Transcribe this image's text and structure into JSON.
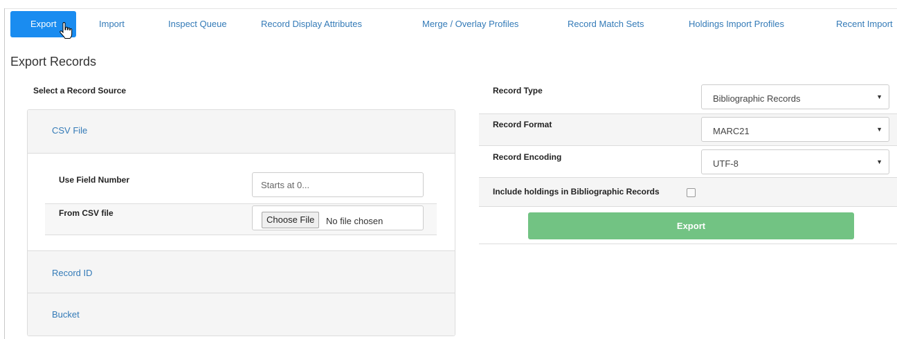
{
  "tabs": [
    {
      "label": "Export",
      "active": true
    },
    {
      "label": "Import"
    },
    {
      "label": "Inspect Queue"
    },
    {
      "label": "Record Display Attributes"
    },
    {
      "label": "Merge / Overlay Profiles"
    },
    {
      "label": "Record Match Sets"
    },
    {
      "label": "Holdings Import Profiles"
    },
    {
      "label": "Recent Import"
    }
  ],
  "page": {
    "title": "Export Records"
  },
  "source": {
    "heading": "Select a Record Source",
    "panels": {
      "csv": "CSV File",
      "record_id": "Record ID",
      "bucket": "Bucket"
    },
    "field_number_label": "Use Field Number",
    "field_number_placeholder": "Starts at 0...",
    "csv_file_label": "From CSV file",
    "choose_file_label": "Choose File",
    "file_status": "No file chosen"
  },
  "options": {
    "record_type": {
      "label": "Record Type",
      "value": "Bibliographic Records"
    },
    "record_format": {
      "label": "Record Format",
      "value": "MARC21"
    },
    "record_encoding": {
      "label": "Record Encoding",
      "value": "UTF-8"
    },
    "include_holdings": {
      "label": "Include holdings in Bibliographic Records",
      "checked": false
    }
  },
  "export_button": "Export",
  "colors": {
    "active_tab": "#1a8cf0",
    "link": "#337ab7",
    "export_button": "#72c383"
  }
}
